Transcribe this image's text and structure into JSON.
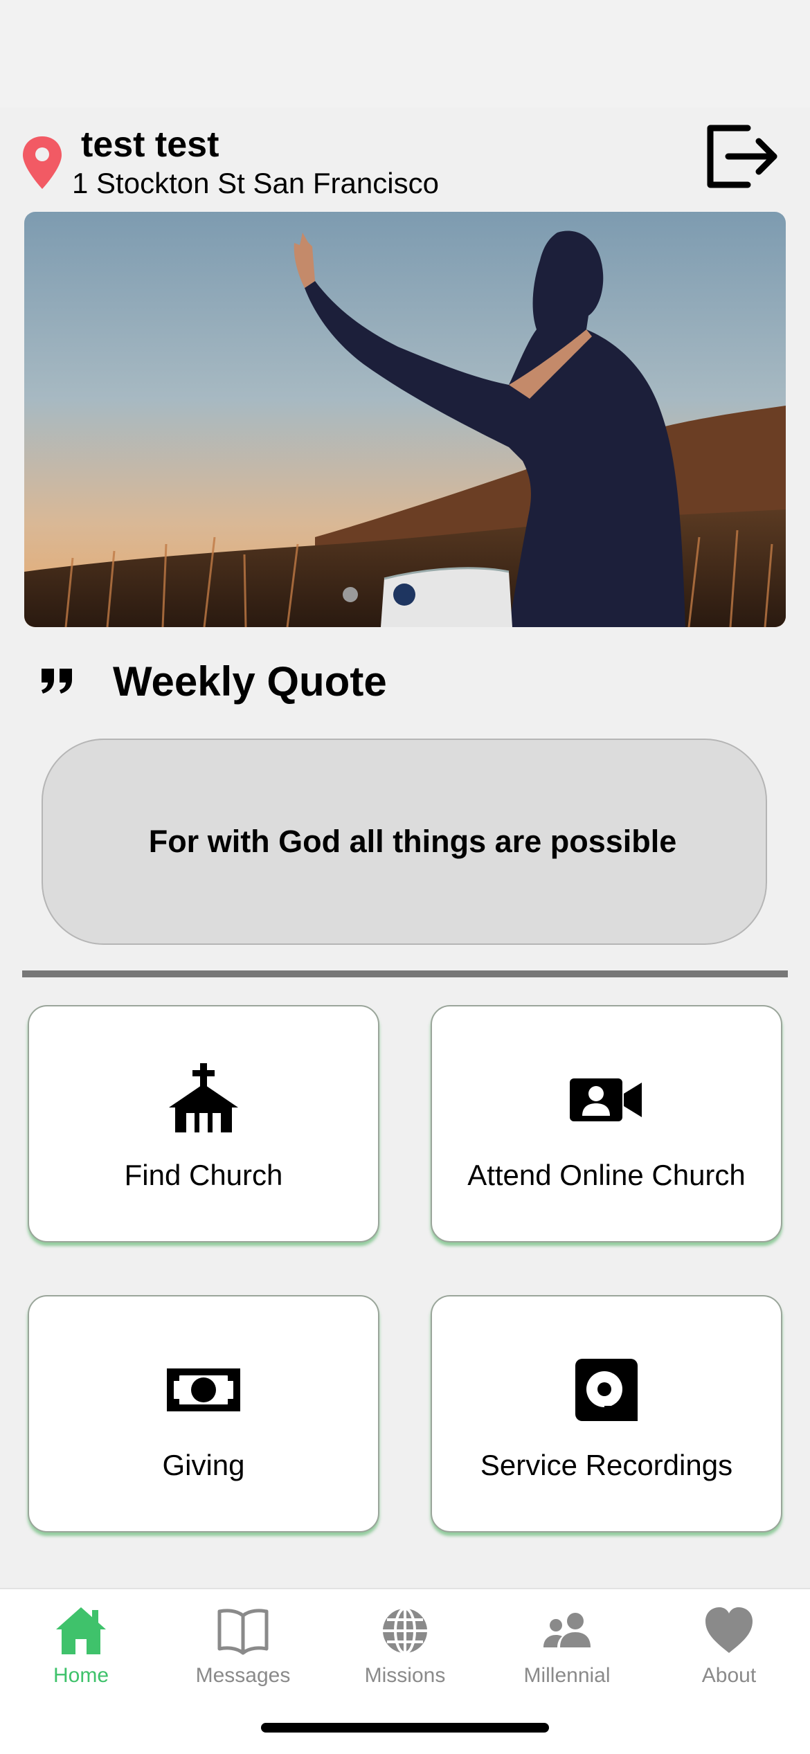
{
  "header": {
    "user_name": "test test",
    "address": "1 Stockton St San Francisco",
    "pin_icon": "map-pin-icon",
    "logout_icon": "logout-icon",
    "pin_color": "#f25a64"
  },
  "banner": {
    "image_description": "",
    "pager": {
      "total": 2,
      "active": 2
    }
  },
  "weekly_quote": {
    "icon": "quote-icon",
    "heading": "Weekly Quote",
    "text": "For with God all things are possible"
  },
  "tiles": [
    {
      "label": "Find Church",
      "icon": "church-icon"
    },
    {
      "label": "Attend Online Church",
      "icon": "video-camera-icon"
    },
    {
      "label": "Giving",
      "icon": "money-icon"
    },
    {
      "label": "Service Recordings",
      "icon": "recording-icon"
    }
  ],
  "tab_bar": {
    "active_index": 0,
    "active_color": "#3fc26b",
    "inactive_color": "#8a8a8a",
    "items": [
      {
        "label": "Home",
        "icon": "home-icon"
      },
      {
        "label": "Messages",
        "icon": "book-icon"
      },
      {
        "label": "Missions",
        "icon": "globe-icon"
      },
      {
        "label": "Millennial",
        "icon": "people-icon"
      },
      {
        "label": "About",
        "icon": "heart-icon"
      }
    ]
  }
}
